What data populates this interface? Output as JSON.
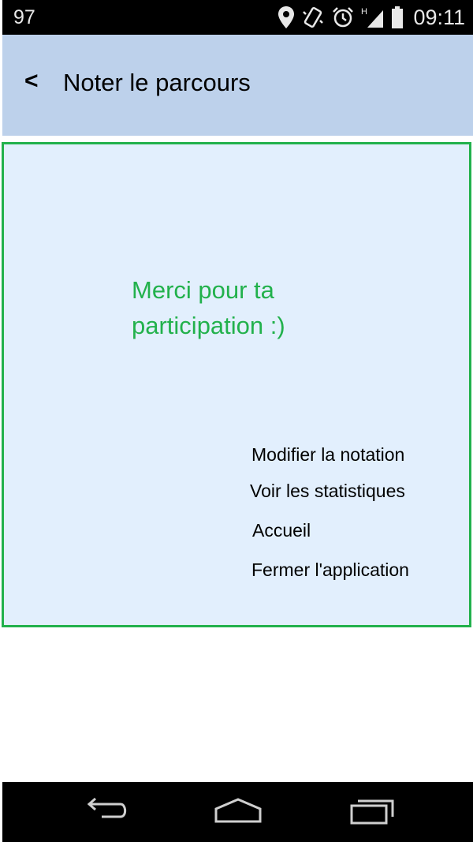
{
  "status_bar": {
    "left_text": "97",
    "time": "09:11",
    "icons": [
      "location-icon",
      "vibrate-icon",
      "alarm-icon",
      "signal-h-icon",
      "battery-icon"
    ]
  },
  "app_bar": {
    "back_label": "<",
    "title": "Noter le parcours",
    "background": "#bdd1eb"
  },
  "card": {
    "message": "Merci pour ta participation :)",
    "accent_color": "#22b14c",
    "background": "#e2effd",
    "actions": [
      {
        "label": "Modifier la notation"
      },
      {
        "label": "Voir les statistiques"
      },
      {
        "label": "Accueil"
      },
      {
        "label": "Fermer l'application"
      }
    ]
  },
  "nav_bar": {
    "icons": [
      "back-icon",
      "home-icon",
      "recent-apps-icon"
    ]
  }
}
